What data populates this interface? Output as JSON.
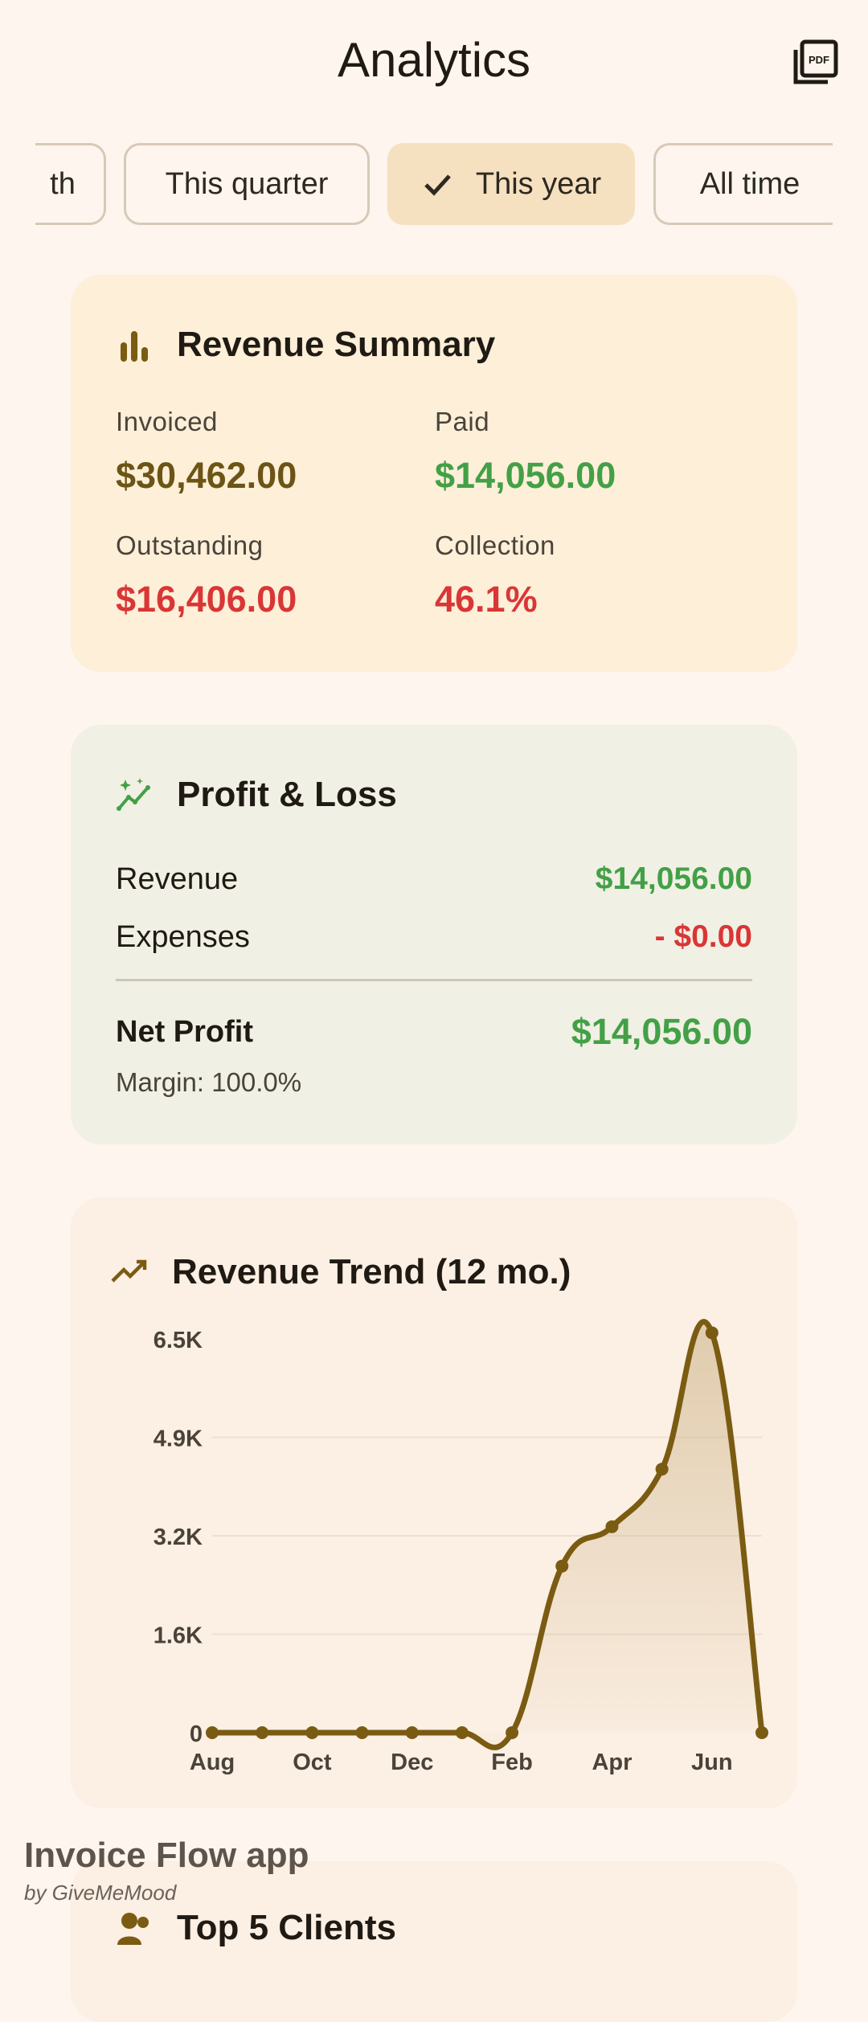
{
  "header": {
    "title": "Analytics",
    "pdf_icon": "pdf-export-icon"
  },
  "filters": {
    "chips": [
      "th",
      "This quarter",
      "This year",
      "All time"
    ],
    "selected": "This year"
  },
  "revenue_summary": {
    "title": "Revenue Summary",
    "icon": "bar-chart-icon",
    "invoiced_label": "Invoiced",
    "invoiced_value": "$30,462.00",
    "paid_label": "Paid",
    "paid_value": "$14,056.00",
    "outstanding_label": "Outstanding",
    "outstanding_value": "$16,406.00",
    "collection_label": "Collection",
    "collection_value": "46.1%",
    "colors": {
      "invoiced": "#6b5415",
      "paid": "#43a047",
      "outstanding": "#d93636",
      "collection": "#d93636"
    }
  },
  "profit_loss": {
    "title": "Profit & Loss",
    "icon": "sparkle-trend-icon",
    "revenue_label": "Revenue",
    "revenue_value": "$14,056.00",
    "expenses_label": "Expenses",
    "expenses_value": "- $0.00",
    "net_label": "Net Profit",
    "net_value": "$14,056.00",
    "margin_text": "Margin: 100.0%"
  },
  "revenue_trend": {
    "title": "Revenue Trend (12 mo.)",
    "icon": "trend-line-icon"
  },
  "chart_data": {
    "type": "area",
    "title": "Revenue Trend (12 mo.)",
    "x_tick_labels": [
      "Aug",
      "Oct",
      "Dec",
      "Feb",
      "Apr",
      "Jun"
    ],
    "y_tick_labels": [
      "0",
      "1.6K",
      "3.2K",
      "4.9K",
      "6.5K"
    ],
    "ylim": [
      0,
      6500
    ],
    "grid": true,
    "color": "#7a5b12",
    "series": [
      {
        "x": [
          "Aug",
          "Sep",
          "Oct",
          "Nov",
          "Dec",
          "Jan",
          "Feb",
          "Mar",
          "Apr",
          "May",
          "Jun",
          "Jul"
        ],
        "values": [
          0,
          0,
          0,
          0,
          0,
          0,
          0,
          2750,
          3400,
          4350,
          6600,
          0
        ]
      }
    ]
  },
  "top_clients": {
    "title": "Top 5 Clients",
    "icon": "people-icon"
  },
  "branding": {
    "name": "Invoice Flow app",
    "by": "by GiveMeMood"
  }
}
